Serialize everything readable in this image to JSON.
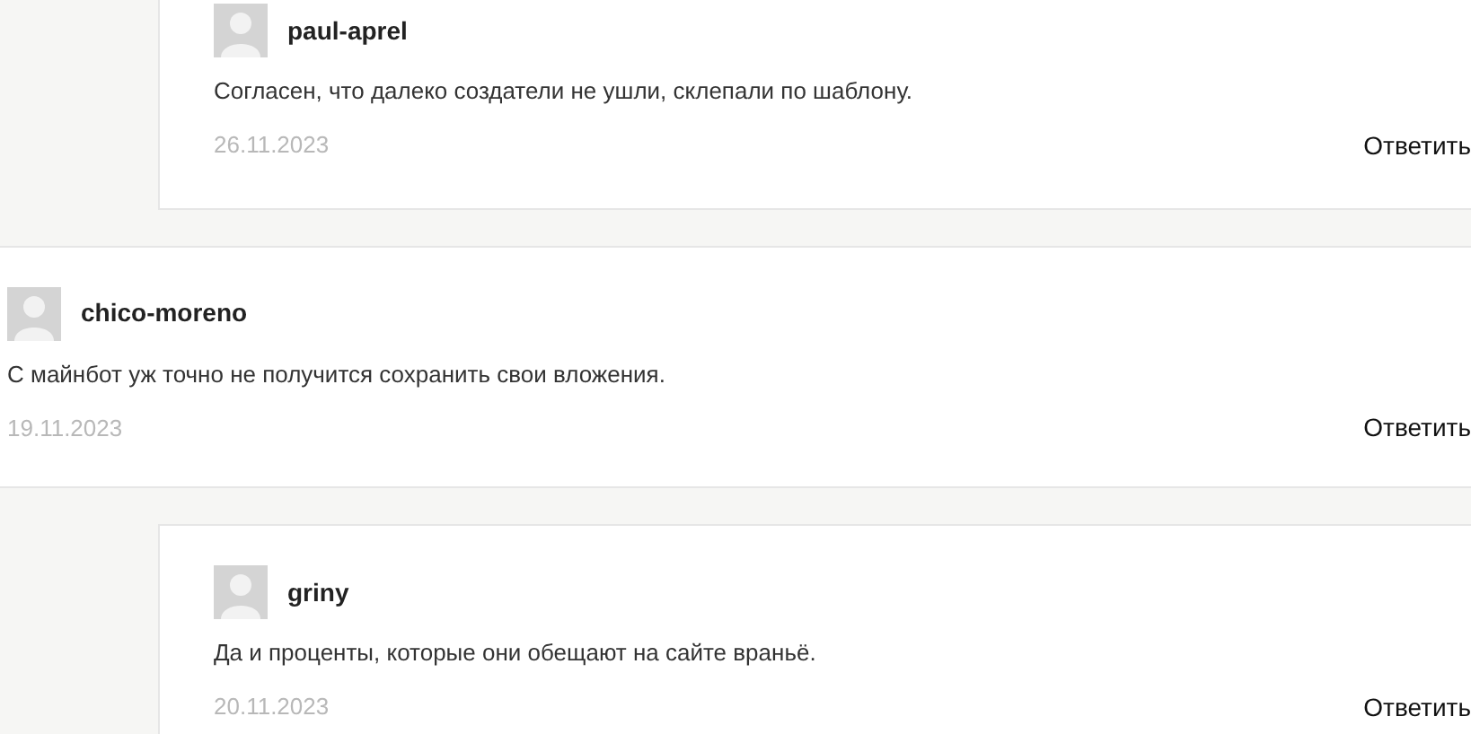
{
  "comments": [
    {
      "kind": "reply",
      "author": "paul-aprel",
      "text": "Согласен, что далеко создатели не ушли, склепали по шаблону.",
      "date": "26.11.2023",
      "reply": "Ответить"
    },
    {
      "kind": "top",
      "author": "chico-moreno",
      "text": "С майнбот уж точно не получится сохранить свои вложения.",
      "date": "19.11.2023",
      "reply": "Ответить"
    },
    {
      "kind": "reply",
      "author": "griny",
      "text": "Да и проценты, которые они обещают на сайте враньё.",
      "date": "20.11.2023",
      "reply": "Ответить"
    }
  ]
}
